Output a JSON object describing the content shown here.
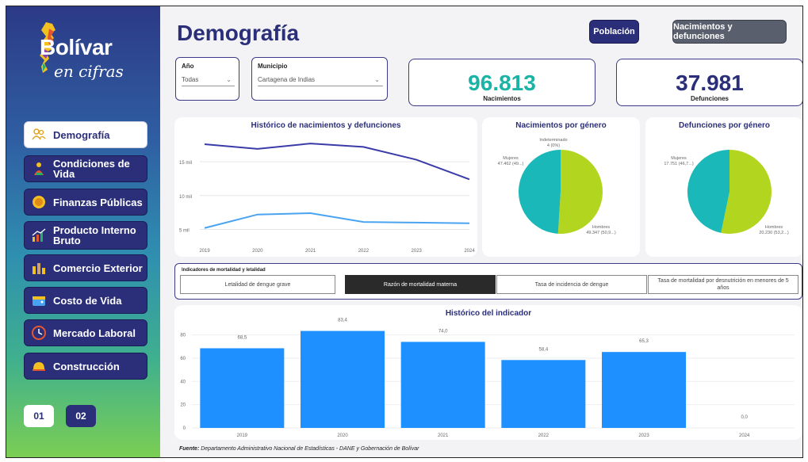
{
  "brand": {
    "title": "Bolívar",
    "subtitle": "en cifras"
  },
  "nav": {
    "items": [
      {
        "label": "Demografía",
        "icon": "people-icon"
      },
      {
        "label": "Condiciones de Vida",
        "icon": "person-icon"
      },
      {
        "label": "Finanzas Públicas",
        "icon": "coin-icon"
      },
      {
        "label": "Producto Interno Bruto",
        "icon": "bar-growth-icon"
      },
      {
        "label": "Comercio Exterior",
        "icon": "bars-icon"
      },
      {
        "label": "Costo de Vida",
        "icon": "wallet-icon"
      },
      {
        "label": "Mercado Laboral",
        "icon": "clock-icon"
      },
      {
        "label": "Construcción",
        "icon": "helmet-icon"
      }
    ],
    "pages": [
      "01",
      "02"
    ]
  },
  "header": {
    "title": "Demografía",
    "buttons": [
      "Población",
      "Nacimientos y defunciones"
    ]
  },
  "filters": {
    "year": {
      "label": "Año",
      "value": "Todas"
    },
    "municipality": {
      "label": "Municipio",
      "value": "Cartagena de Indias"
    }
  },
  "kpis": {
    "births": {
      "value": "96.813",
      "label": "Nacimientos",
      "color": "#1ab3a6"
    },
    "deaths": {
      "value": "37.981",
      "label": "Defunciones",
      "color": "#2b2f7a"
    }
  },
  "chart_data": [
    {
      "type": "line",
      "title": "Histórico de nacimientos y defunciones",
      "x": [
        "2019",
        "2020",
        "2021",
        "2022",
        "2023",
        "2024"
      ],
      "yticks": [
        "15 mil",
        "10 mil",
        "5 mil"
      ],
      "ylim": [
        4000,
        19000
      ],
      "series": [
        {
          "values": [
            17600,
            16900,
            17700,
            17200,
            15300,
            12400
          ],
          "color": "#3b3ba8"
        },
        {
          "values": [
            5200,
            7200,
            7400,
            6100,
            6000,
            5900
          ],
          "color": "#4aa3f0"
        }
      ]
    },
    {
      "type": "pie",
      "title": "Nacimientos por género",
      "slices": [
        {
          "label": "Hombres",
          "value": 49347,
          "text": "49.347 (50,9...)",
          "color": "#b2d620"
        },
        {
          "label": "Mujeres",
          "value": 47462,
          "text": "47.462 (49...)",
          "color": "#1ab8b8"
        },
        {
          "label": "Indeterminado",
          "value": 4,
          "text": "4 (0%)",
          "color": "#2b2f7a"
        }
      ]
    },
    {
      "type": "pie",
      "title": "Defunciones por género",
      "slices": [
        {
          "label": "Hombres",
          "value": 20230,
          "text": "20.230 (53,2...)",
          "color": "#b2d620"
        },
        {
          "label": "Mujeres",
          "value": 17751,
          "text": "17.751 (46,7...)",
          "color": "#1ab8b8"
        }
      ]
    },
    {
      "type": "bar",
      "title": "Histórico del indicador",
      "categories": [
        "2019",
        "2020",
        "2021",
        "2022",
        "2023",
        "2024"
      ],
      "values": [
        68.5,
        83.4,
        74.0,
        58.4,
        65.3,
        0.0
      ],
      "labels": [
        "68,5",
        "83,4",
        "74,0",
        "58,4",
        "65,3",
        "0,0"
      ],
      "yticks": [
        0,
        20,
        40,
        60,
        80
      ],
      "ylim": [
        0,
        92
      ],
      "color": "#1e90ff"
    }
  ],
  "indicators": {
    "title": "Indicadores de mortalidad y letalidad",
    "tabs": [
      "Letalidad de dengue grave",
      "Razón de mortalidad materna",
      "Tasa de incidencia de dengue",
      "Tasa de mortalidad por desnutrición en menores de 5 años"
    ],
    "active": 1
  },
  "source": {
    "prefix": "Fuente:",
    "text": " Departamento Administrativo Nacional de Estadísticas - DANE y Gobernación de Bolívar"
  },
  "colors": {
    "navy": "#2b2f7a",
    "teal": "#1ab3a6",
    "lime": "#b2d620",
    "bar": "#1e90ff"
  }
}
